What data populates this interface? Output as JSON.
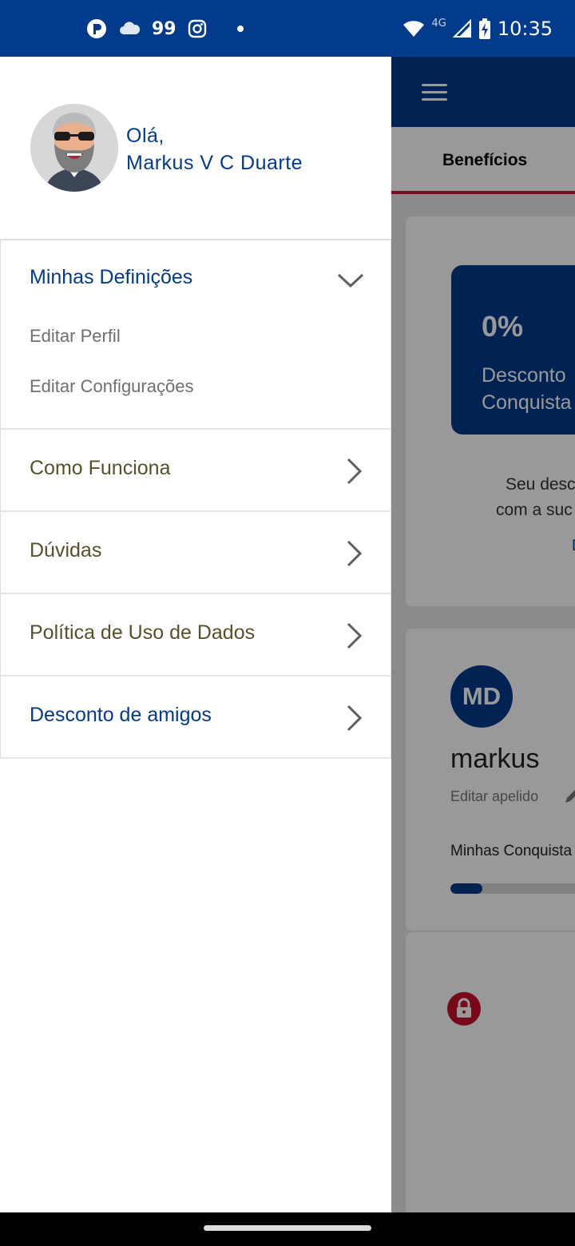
{
  "status_bar": {
    "left_icons": [
      "p-shield-icon",
      "cloud-icon",
      "instagram-icon",
      "dot-icon"
    ],
    "badge": "99",
    "network": "4G",
    "time": "10:35",
    "right_icons": [
      "wifi-icon",
      "signal-icon",
      "battery-charging-icon"
    ]
  },
  "drawer": {
    "greeting": "Olá,",
    "user_name": "Markus V C Duarte",
    "avatar": "bearded-man-sunglasses-avatar",
    "sections": [
      {
        "title": "Minhas Definições",
        "expanded": true,
        "sub_items": [
          "Editar Perfil",
          "Editar Configurações"
        ]
      },
      {
        "title": "Como Funciona"
      },
      {
        "title": "Dúvidas"
      },
      {
        "title": "Política de Uso de Dados"
      },
      {
        "title": "Desconto de amigos"
      }
    ]
  },
  "background_app": {
    "tab_label": "Benefícios",
    "discount_value": "0%",
    "discount_label_line1": "Desconto",
    "discount_label_line2": "Conquista",
    "info_line1": "Seu desc",
    "info_line2": "com a suc",
    "link_fragment": "D",
    "avatar_initials": "MD",
    "nickname": "markus",
    "edit_nickname_label": "Editar apelido",
    "achievements_label": "Minhas Conquista",
    "achievements_progress": 0.22
  },
  "colors": {
    "brand_blue": "#033b8c",
    "accent_red": "#d0103a",
    "olive_text": "#55512a"
  }
}
